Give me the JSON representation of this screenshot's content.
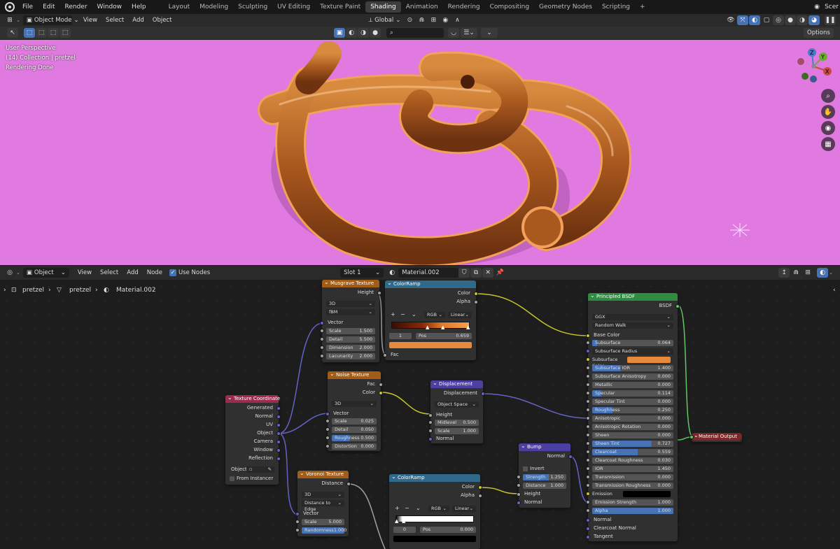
{
  "topbar": {
    "menus": [
      "File",
      "Edit",
      "Render",
      "Window",
      "Help"
    ],
    "workspaces": [
      "Layout",
      "Modeling",
      "Sculpting",
      "UV Editing",
      "Texture Paint",
      "Shading",
      "Animation",
      "Rendering",
      "Compositing",
      "Geometry Nodes",
      "Scripting",
      "+"
    ],
    "active_workspace": "Shading",
    "scene_label": "Scer"
  },
  "viewport_header": {
    "mode": "Object Mode",
    "menus": [
      "View",
      "Select",
      "Add",
      "Object"
    ],
    "transform_orientation": "Global",
    "options_label": "Options"
  },
  "viewport": {
    "overlay_lines": [
      "User Perspective",
      "(14) Collection | pretzel",
      "Rendering Done"
    ],
    "gizmo_axes": [
      "X",
      "Y",
      "Z"
    ]
  },
  "node_header": {
    "editor_type": "Object",
    "menus": [
      "View",
      "Select",
      "Add",
      "Node"
    ],
    "use_nodes_label": "Use Nodes",
    "slot": "Slot 1",
    "material": "Material.002"
  },
  "breadcrumb": {
    "object": "pretzel",
    "mesh": "pretzel",
    "material": "Material.002"
  },
  "nodes": {
    "musgrave": {
      "title": "Musgrave Texture",
      "out_height": "Height",
      "dim": "3D",
      "type": "fBM",
      "in_vector": "Vector",
      "fields": [
        {
          "l": "Scale",
          "v": "1.500"
        },
        {
          "l": "Detail",
          "v": "5.500"
        },
        {
          "l": "Dimension",
          "v": "2.000"
        },
        {
          "l": "Lacunarity",
          "v": "2.000"
        }
      ]
    },
    "colorramp1": {
      "title": "ColorRamp",
      "out_color": "Color",
      "out_alpha": "Alpha",
      "mode": "RGB",
      "interp": "Linear",
      "idx": "1",
      "pos_l": "Pos",
      "pos_v": "0.659",
      "in_fac": "Fac"
    },
    "noise": {
      "title": "Noise Texture",
      "out_fac": "Fac",
      "out_color": "Color",
      "dim": "3D",
      "in_vector": "Vector",
      "fields": [
        {
          "l": "Scale",
          "v": "0.025"
        },
        {
          "l": "Detail",
          "v": "0.050"
        },
        {
          "l": "Roughness",
          "v": "0.500"
        },
        {
          "l": "Distortion",
          "v": "0.000"
        }
      ]
    },
    "displacement": {
      "title": "Displacement",
      "out": "Displacement",
      "space": "Object Space",
      "in_height": "Height",
      "fields": [
        {
          "l": "Midlevel",
          "v": "0.500"
        },
        {
          "l": "Scale",
          "v": "1.000"
        }
      ],
      "in_normal": "Normal"
    },
    "texcoord": {
      "title": "Texture Coordinate",
      "outs": [
        "Generated",
        "Normal",
        "UV",
        "Object",
        "Camera",
        "Window",
        "Reflection"
      ],
      "object_label": "Object:",
      "from_instancer": "From Instancer"
    },
    "voronoi": {
      "title": "Voronoi Texture",
      "out_distance": "Distance",
      "dim": "3D",
      "feature": "Distance to Edge",
      "in_vector": "Vector",
      "fields": [
        {
          "l": "Scale",
          "v": "5.000"
        },
        {
          "l": "Randomness",
          "v": "1.000"
        }
      ]
    },
    "colorramp2": {
      "title": "ColorRamp",
      "out_color": "Color",
      "out_alpha": "Alpha",
      "mode": "RGB",
      "interp": "Linear",
      "idx": "0",
      "pos_l": "Pos",
      "pos_v": "0.000"
    },
    "bump": {
      "title": "Bump",
      "out_normal": "Normal",
      "invert": "Invert",
      "fields": [
        {
          "l": "Strength",
          "v": "1.250"
        },
        {
          "l": "Distance",
          "v": "1.000"
        }
      ],
      "in_height": "Height",
      "in_normal": "Normal"
    },
    "bsdf": {
      "title": "Principled BSDF",
      "out": "BSDF",
      "distribution": "GGX",
      "sss_method": "Random Walk",
      "base_color": "Base Color",
      "fields": [
        {
          "l": "Subsurface",
          "v": "0.064",
          "fill": 0.06
        },
        {
          "l": "Subsurface Radius",
          "v": "",
          "sel": true
        },
        {
          "l": "Subsurface Color",
          "v": "",
          "color": "#e58a3c"
        },
        {
          "l": "Subsurface IOR",
          "v": "1.400",
          "fill": 0.35
        },
        {
          "l": "Subsurface Anisotropy",
          "v": "0.000"
        },
        {
          "l": "Metallic",
          "v": "0.000"
        },
        {
          "l": "Specular",
          "v": "0.114",
          "fill": 0.11
        },
        {
          "l": "Specular Tint",
          "v": "0.000"
        },
        {
          "l": "Roughness",
          "v": "0.250",
          "fill": 0.25
        },
        {
          "l": "Anisotropic",
          "v": "0.000"
        },
        {
          "l": "Anisotropic Rotation",
          "v": "0.000"
        },
        {
          "l": "Sheen",
          "v": "0.000"
        },
        {
          "l": "Sheen Tint",
          "v": "0.727",
          "fill": 0.727
        },
        {
          "l": "Clearcoat",
          "v": "0.559",
          "fill": 0.559
        },
        {
          "l": "Clearcoat Roughness",
          "v": "0.030"
        },
        {
          "l": "IOR",
          "v": "1.450"
        },
        {
          "l": "Transmission",
          "v": "0.000"
        },
        {
          "l": "Transmission Roughness",
          "v": "0.000"
        },
        {
          "l": "Emission",
          "v": "",
          "color": "#000000"
        },
        {
          "l": "Emission Strength",
          "v": "1.000"
        },
        {
          "l": "Alpha",
          "v": "1.000",
          "fill": 1.0
        }
      ],
      "ins_bottom": [
        "Normal",
        "Clearcoat Normal",
        "Tangent"
      ]
    },
    "matout": {
      "title": "Material Output"
    }
  },
  "colors": {
    "viewport_bg": "#e079e0",
    "pretzel": "#b8642a",
    "accent": "#4772b3"
  }
}
